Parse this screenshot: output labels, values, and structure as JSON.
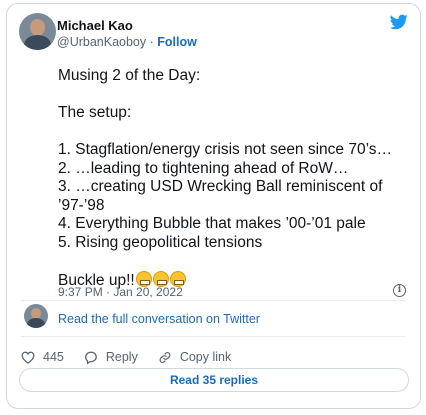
{
  "author": {
    "name": "Michael Kao",
    "handle": "@UrbanKaoboy",
    "separator": "·",
    "follow_label": "Follow"
  },
  "tweet": {
    "lines": [
      "Musing 2 of the Day:",
      "",
      "The setup:",
      "",
      "1. Stagflation/energy crisis not seen since 70’s…",
      "2. …leading to tightening ahead of RoW…",
      "3. …creating USD Wrecking Ball reminiscent of",
      "’97-’98",
      "4. Everything Bubble that makes ’00-’01 pale",
      "5. Rising geopolitical tensions",
      ""
    ],
    "closing": "Buckle up!!",
    "emoji_count": 3,
    "emoji_name": "grimacing-face-emoji",
    "timestamp": "9:37 PM · Jan 20, 2022",
    "info_glyph": "i"
  },
  "conversation": {
    "link_label": "Read the full conversation on Twitter"
  },
  "actions": {
    "likes_count": "445",
    "reply_label": "Reply",
    "copy_link_label": "Copy link"
  },
  "replies_button": {
    "label": "Read 35 replies"
  },
  "colors": {
    "twitter_blue": "#1d9bf0",
    "link_blue": "#1d6ab3",
    "muted_gray": "#536471",
    "border": "#cfd9de"
  },
  "icons": {
    "logo": "twitter-bird-icon",
    "info": "info-icon",
    "like": "heart-icon",
    "reply": "reply-bubble-icon",
    "copy": "link-icon"
  }
}
